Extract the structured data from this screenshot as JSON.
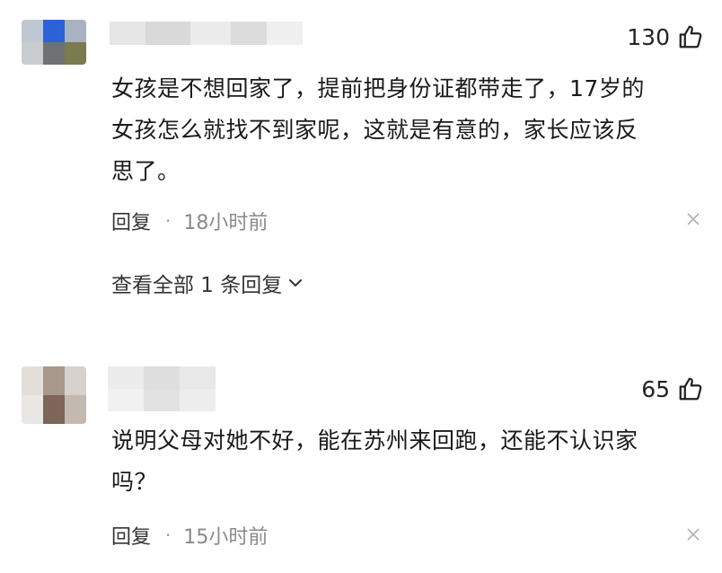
{
  "comments": [
    {
      "likes": "130",
      "text_lines": [
        "女孩是不想回家了，提前把身份证都带走了，17岁的",
        "女孩怎么就找不到家呢，这就是有意的，家长应该反",
        "思了。"
      ],
      "reply_label": "回复",
      "separator": "·",
      "time": "18小时前",
      "expand_label": "查看全部 1 条回复"
    },
    {
      "likes": "65",
      "text_lines": [
        "说明父母对她不好，能在苏州来回跑，还能不认识家",
        "吗？"
      ],
      "reply_label": "回复",
      "separator": "·",
      "time": "15小时前"
    }
  ],
  "icons": {
    "like": "thumbs-up-icon",
    "close": "close-icon",
    "expand": "chevron-down-icon"
  },
  "colors": {
    "text": "#1a1a1a",
    "meta_time": "#8a8a8a",
    "separator": "#999999"
  }
}
